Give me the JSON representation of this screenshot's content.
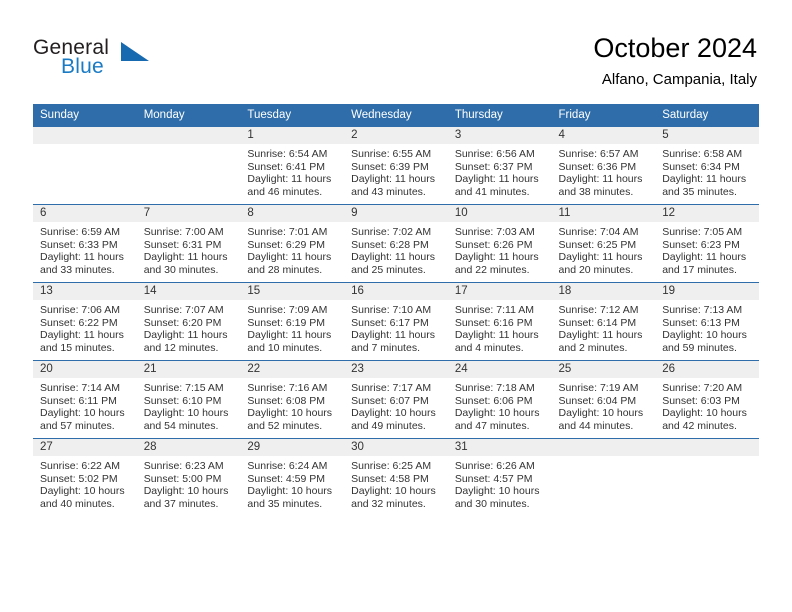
{
  "brand": {
    "word1": "General",
    "word2": "Blue",
    "triangle_color": "#1769b0",
    "blue_text_color": "#1a7bc4"
  },
  "header": {
    "title": "October 2024",
    "location": "Alfano, Campania, Italy"
  },
  "theme": {
    "header_blue": "#2e6da9",
    "daynum_band": "#efefef",
    "text": "#333333"
  },
  "weekday_headers": [
    "Sunday",
    "Monday",
    "Tuesday",
    "Wednesday",
    "Thursday",
    "Friday",
    "Saturday"
  ],
  "labels": {
    "sunrise_prefix": "Sunrise:",
    "sunset_prefix": "Sunset:",
    "daylight_prefix": "Daylight:"
  },
  "weeks": [
    [
      {
        "day": "",
        "empty": true
      },
      {
        "day": "",
        "empty": true
      },
      {
        "day": "1",
        "sunrise": "Sunrise: 6:54 AM",
        "sunset": "Sunset: 6:41 PM",
        "daylight": "Daylight: 11 hours and 46 minutes."
      },
      {
        "day": "2",
        "sunrise": "Sunrise: 6:55 AM",
        "sunset": "Sunset: 6:39 PM",
        "daylight": "Daylight: 11 hours and 43 minutes."
      },
      {
        "day": "3",
        "sunrise": "Sunrise: 6:56 AM",
        "sunset": "Sunset: 6:37 PM",
        "daylight": "Daylight: 11 hours and 41 minutes."
      },
      {
        "day": "4",
        "sunrise": "Sunrise: 6:57 AM",
        "sunset": "Sunset: 6:36 PM",
        "daylight": "Daylight: 11 hours and 38 minutes."
      },
      {
        "day": "5",
        "sunrise": "Sunrise: 6:58 AM",
        "sunset": "Sunset: 6:34 PM",
        "daylight": "Daylight: 11 hours and 35 minutes."
      }
    ],
    [
      {
        "day": "6",
        "sunrise": "Sunrise: 6:59 AM",
        "sunset": "Sunset: 6:33 PM",
        "daylight": "Daylight: 11 hours and 33 minutes."
      },
      {
        "day": "7",
        "sunrise": "Sunrise: 7:00 AM",
        "sunset": "Sunset: 6:31 PM",
        "daylight": "Daylight: 11 hours and 30 minutes."
      },
      {
        "day": "8",
        "sunrise": "Sunrise: 7:01 AM",
        "sunset": "Sunset: 6:29 PM",
        "daylight": "Daylight: 11 hours and 28 minutes."
      },
      {
        "day": "9",
        "sunrise": "Sunrise: 7:02 AM",
        "sunset": "Sunset: 6:28 PM",
        "daylight": "Daylight: 11 hours and 25 minutes."
      },
      {
        "day": "10",
        "sunrise": "Sunrise: 7:03 AM",
        "sunset": "Sunset: 6:26 PM",
        "daylight": "Daylight: 11 hours and 22 minutes."
      },
      {
        "day": "11",
        "sunrise": "Sunrise: 7:04 AM",
        "sunset": "Sunset: 6:25 PM",
        "daylight": "Daylight: 11 hours and 20 minutes."
      },
      {
        "day": "12",
        "sunrise": "Sunrise: 7:05 AM",
        "sunset": "Sunset: 6:23 PM",
        "daylight": "Daylight: 11 hours and 17 minutes."
      }
    ],
    [
      {
        "day": "13",
        "sunrise": "Sunrise: 7:06 AM",
        "sunset": "Sunset: 6:22 PM",
        "daylight": "Daylight: 11 hours and 15 minutes."
      },
      {
        "day": "14",
        "sunrise": "Sunrise: 7:07 AM",
        "sunset": "Sunset: 6:20 PM",
        "daylight": "Daylight: 11 hours and 12 minutes."
      },
      {
        "day": "15",
        "sunrise": "Sunrise: 7:09 AM",
        "sunset": "Sunset: 6:19 PM",
        "daylight": "Daylight: 11 hours and 10 minutes."
      },
      {
        "day": "16",
        "sunrise": "Sunrise: 7:10 AM",
        "sunset": "Sunset: 6:17 PM",
        "daylight": "Daylight: 11 hours and 7 minutes."
      },
      {
        "day": "17",
        "sunrise": "Sunrise: 7:11 AM",
        "sunset": "Sunset: 6:16 PM",
        "daylight": "Daylight: 11 hours and 4 minutes."
      },
      {
        "day": "18",
        "sunrise": "Sunrise: 7:12 AM",
        "sunset": "Sunset: 6:14 PM",
        "daylight": "Daylight: 11 hours and 2 minutes."
      },
      {
        "day": "19",
        "sunrise": "Sunrise: 7:13 AM",
        "sunset": "Sunset: 6:13 PM",
        "daylight": "Daylight: 10 hours and 59 minutes."
      }
    ],
    [
      {
        "day": "20",
        "sunrise": "Sunrise: 7:14 AM",
        "sunset": "Sunset: 6:11 PM",
        "daylight": "Daylight: 10 hours and 57 minutes."
      },
      {
        "day": "21",
        "sunrise": "Sunrise: 7:15 AM",
        "sunset": "Sunset: 6:10 PM",
        "daylight": "Daylight: 10 hours and 54 minutes."
      },
      {
        "day": "22",
        "sunrise": "Sunrise: 7:16 AM",
        "sunset": "Sunset: 6:08 PM",
        "daylight": "Daylight: 10 hours and 52 minutes."
      },
      {
        "day": "23",
        "sunrise": "Sunrise: 7:17 AM",
        "sunset": "Sunset: 6:07 PM",
        "daylight": "Daylight: 10 hours and 49 minutes."
      },
      {
        "day": "24",
        "sunrise": "Sunrise: 7:18 AM",
        "sunset": "Sunset: 6:06 PM",
        "daylight": "Daylight: 10 hours and 47 minutes."
      },
      {
        "day": "25",
        "sunrise": "Sunrise: 7:19 AM",
        "sunset": "Sunset: 6:04 PM",
        "daylight": "Daylight: 10 hours and 44 minutes."
      },
      {
        "day": "26",
        "sunrise": "Sunrise: 7:20 AM",
        "sunset": "Sunset: 6:03 PM",
        "daylight": "Daylight: 10 hours and 42 minutes."
      }
    ],
    [
      {
        "day": "27",
        "sunrise": "Sunrise: 6:22 AM",
        "sunset": "Sunset: 5:02 PM",
        "daylight": "Daylight: 10 hours and 40 minutes."
      },
      {
        "day": "28",
        "sunrise": "Sunrise: 6:23 AM",
        "sunset": "Sunset: 5:00 PM",
        "daylight": "Daylight: 10 hours and 37 minutes."
      },
      {
        "day": "29",
        "sunrise": "Sunrise: 6:24 AM",
        "sunset": "Sunset: 4:59 PM",
        "daylight": "Daylight: 10 hours and 35 minutes."
      },
      {
        "day": "30",
        "sunrise": "Sunrise: 6:25 AM",
        "sunset": "Sunset: 4:58 PM",
        "daylight": "Daylight: 10 hours and 32 minutes."
      },
      {
        "day": "31",
        "sunrise": "Sunrise: 6:26 AM",
        "sunset": "Sunset: 4:57 PM",
        "daylight": "Daylight: 10 hours and 30 minutes."
      },
      {
        "day": "",
        "empty": true
      },
      {
        "day": "",
        "empty": true
      }
    ]
  ]
}
